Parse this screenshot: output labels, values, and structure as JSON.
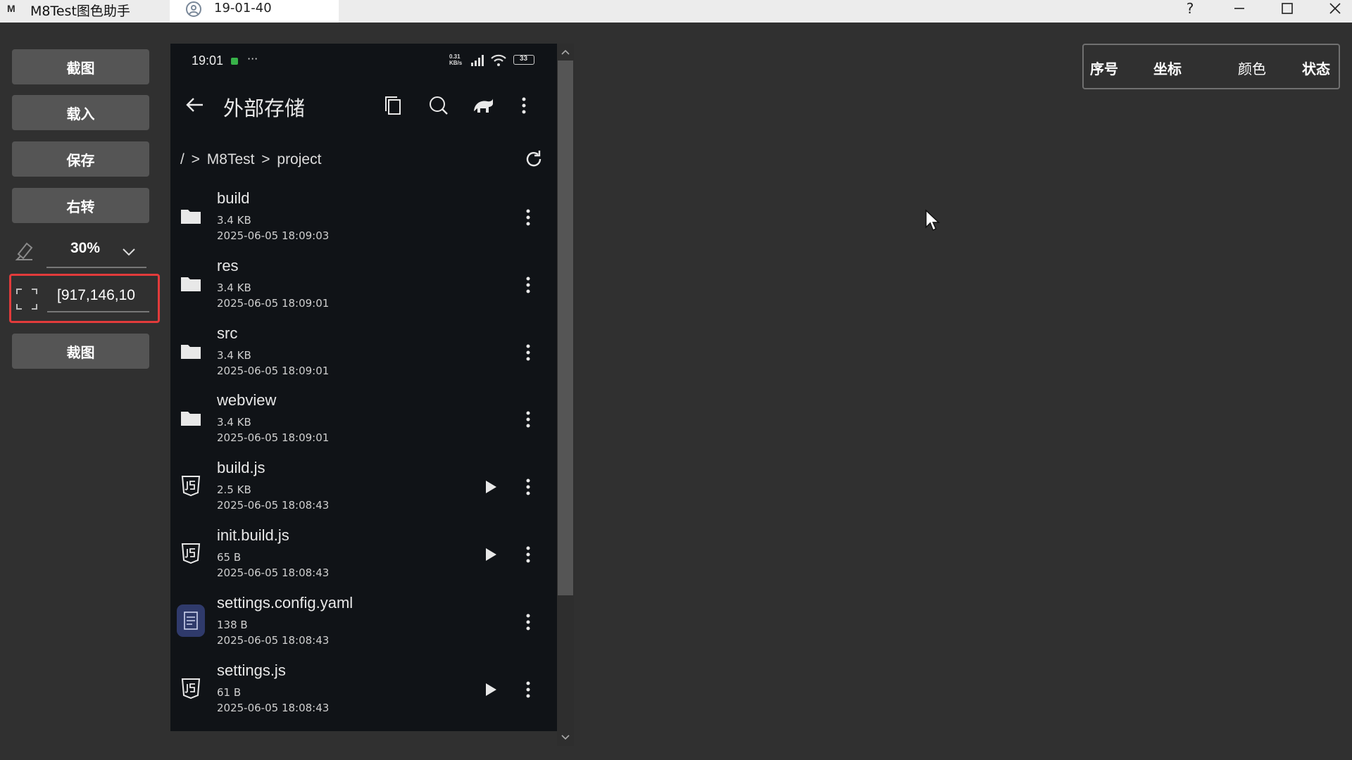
{
  "window": {
    "logo_glyph": "M",
    "app_title": "M8Test图色助手",
    "tab_label": "19-01-40",
    "help_label": "?"
  },
  "toolbar": {
    "capture_label": "截图",
    "load_label": "载入",
    "save_label": "保存",
    "rotate_label": "右转",
    "zoom_value": "30%",
    "coord_value": "[917,146,10",
    "crop_label": "裁图"
  },
  "phone": {
    "status_time": "19:01",
    "status_more": "···",
    "net_speed_top": "0.31",
    "net_speed_bottom": "KB/s",
    "battery": "33",
    "title": "外部存储",
    "breadcrumb": "/  >  M8Test  >  project",
    "files": [
      {
        "name": "build",
        "size": "3.4 KB",
        "date": "2025-06-05 18:09:03",
        "type": "folder",
        "runnable": false
      },
      {
        "name": "res",
        "size": "3.4 KB",
        "date": "2025-06-05 18:09:01",
        "type": "folder",
        "runnable": false
      },
      {
        "name": "src",
        "size": "3.4 KB",
        "date": "2025-06-05 18:09:01",
        "type": "folder",
        "runnable": false
      },
      {
        "name": "webview",
        "size": "3.4 KB",
        "date": "2025-06-05 18:09:01",
        "type": "folder",
        "runnable": false
      },
      {
        "name": "build.js",
        "size": "2.5 KB",
        "date": "2025-06-05 18:08:43",
        "type": "js",
        "runnable": true
      },
      {
        "name": "init.build.js",
        "size": "65 B",
        "date": "2025-06-05 18:08:43",
        "type": "js",
        "runnable": true
      },
      {
        "name": "settings.config.yaml",
        "size": "138 B",
        "date": "2025-06-05 18:08:43",
        "type": "yaml",
        "runnable": false
      },
      {
        "name": "settings.js",
        "size": "61 B",
        "date": "2025-06-05 18:08:43",
        "type": "js",
        "runnable": true
      }
    ]
  },
  "table": {
    "col_index": "序号",
    "col_coord": "坐标",
    "col_color": "颜色",
    "col_status": "状态"
  },
  "colors": {
    "background": "#303030",
    "button": "#555555",
    "highlight_border": "#e23b3b",
    "phone_bg": "#101317"
  },
  "scrollbar": {
    "visible_fraction": 0.8
  }
}
